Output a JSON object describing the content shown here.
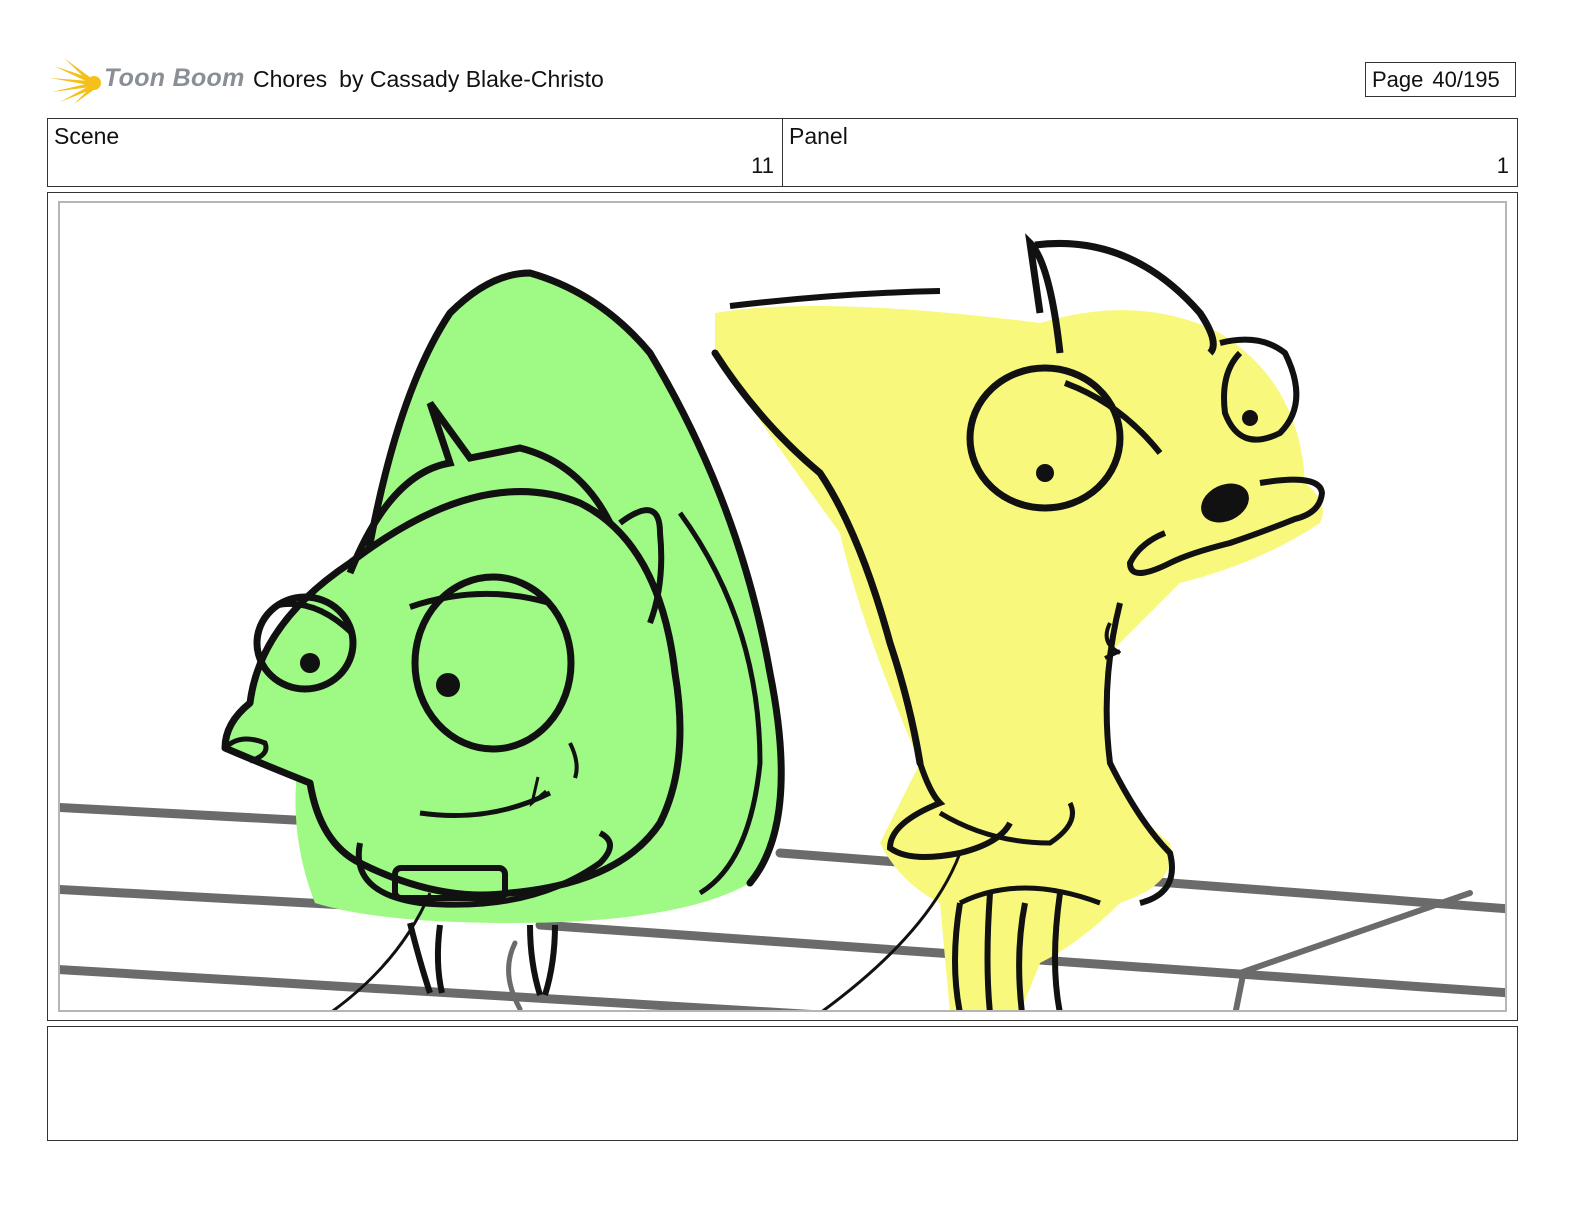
{
  "header": {
    "logo_text": "Toon Boom",
    "title": "Chores",
    "author": "by Cassady Blake-Christo",
    "page_label": "Page",
    "page_number": "40/195"
  },
  "info": {
    "scene_label": "Scene",
    "scene_value": "11",
    "panel_label": "Panel",
    "panel_value": "1"
  },
  "colors": {
    "green_fill": "#9ef985",
    "yellow_fill": "#f8f87c",
    "line": "#111111",
    "rail": "#6b6b6b",
    "logo_star": "#f5c018"
  },
  "notes": ""
}
